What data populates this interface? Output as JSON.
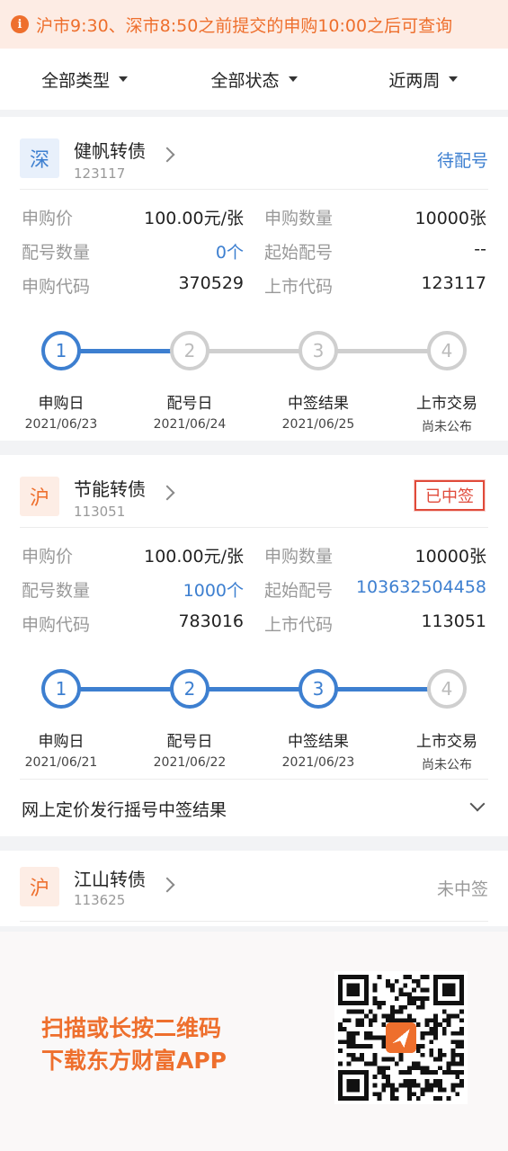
{
  "notice": {
    "icon": "info-icon",
    "text": "沪市9:30、深市8:50之前提交的申购10:00之后可查询"
  },
  "filters": [
    {
      "label": "全部类型"
    },
    {
      "label": "全部状态"
    },
    {
      "label": "近两周"
    }
  ],
  "labels": {
    "price": "申购价",
    "qty": "申购数量",
    "match_qty": "配号数量",
    "start_no": "起始配号",
    "sub_code": "申购代码",
    "list_code": "上市代码"
  },
  "bonds": [
    {
      "market": "深",
      "name": "健帆转债",
      "code": "123117",
      "status": "待配号",
      "price": "100.00元/张",
      "qty": "10000张",
      "match_qty": "0个",
      "start_no": "--",
      "sub_code": "370529",
      "list_code": "123117",
      "steps": [
        {
          "num": "1",
          "label": "申购日",
          "date": "2021/06/23"
        },
        {
          "num": "2",
          "label": "配号日",
          "date": "2021/06/24"
        },
        {
          "num": "3",
          "label": "中签结果",
          "date": "2021/06/25"
        },
        {
          "num": "4",
          "label": "上市交易",
          "date": "尚未公布"
        }
      ],
      "completed_steps": 1
    },
    {
      "market": "沪",
      "name": "节能转债",
      "code": "113051",
      "status": "已中签",
      "price": "100.00元/张",
      "qty": "10000张",
      "match_qty": "1000个",
      "start_no": "103632504458",
      "sub_code": "783016",
      "list_code": "113051",
      "steps": [
        {
          "num": "1",
          "label": "申购日",
          "date": "2021/06/21"
        },
        {
          "num": "2",
          "label": "配号日",
          "date": "2021/06/22"
        },
        {
          "num": "3",
          "label": "中签结果",
          "date": "2021/06/23"
        },
        {
          "num": "4",
          "label": "上市交易",
          "date": "尚未公布"
        }
      ],
      "completed_steps": 3,
      "expand_label": "网上定价发行摇号中签结果"
    },
    {
      "market": "沪",
      "name": "江山转债",
      "code": "113625",
      "status": "未中签"
    }
  ],
  "promo": {
    "line1": "扫描或长按二维码",
    "line2": "下载东方财富APP",
    "qr_icon": "qr-code-icon"
  },
  "colors": {
    "accent": "#3d7fd0",
    "orange": "#ee6f2d",
    "stamp": "#e04a3a"
  }
}
